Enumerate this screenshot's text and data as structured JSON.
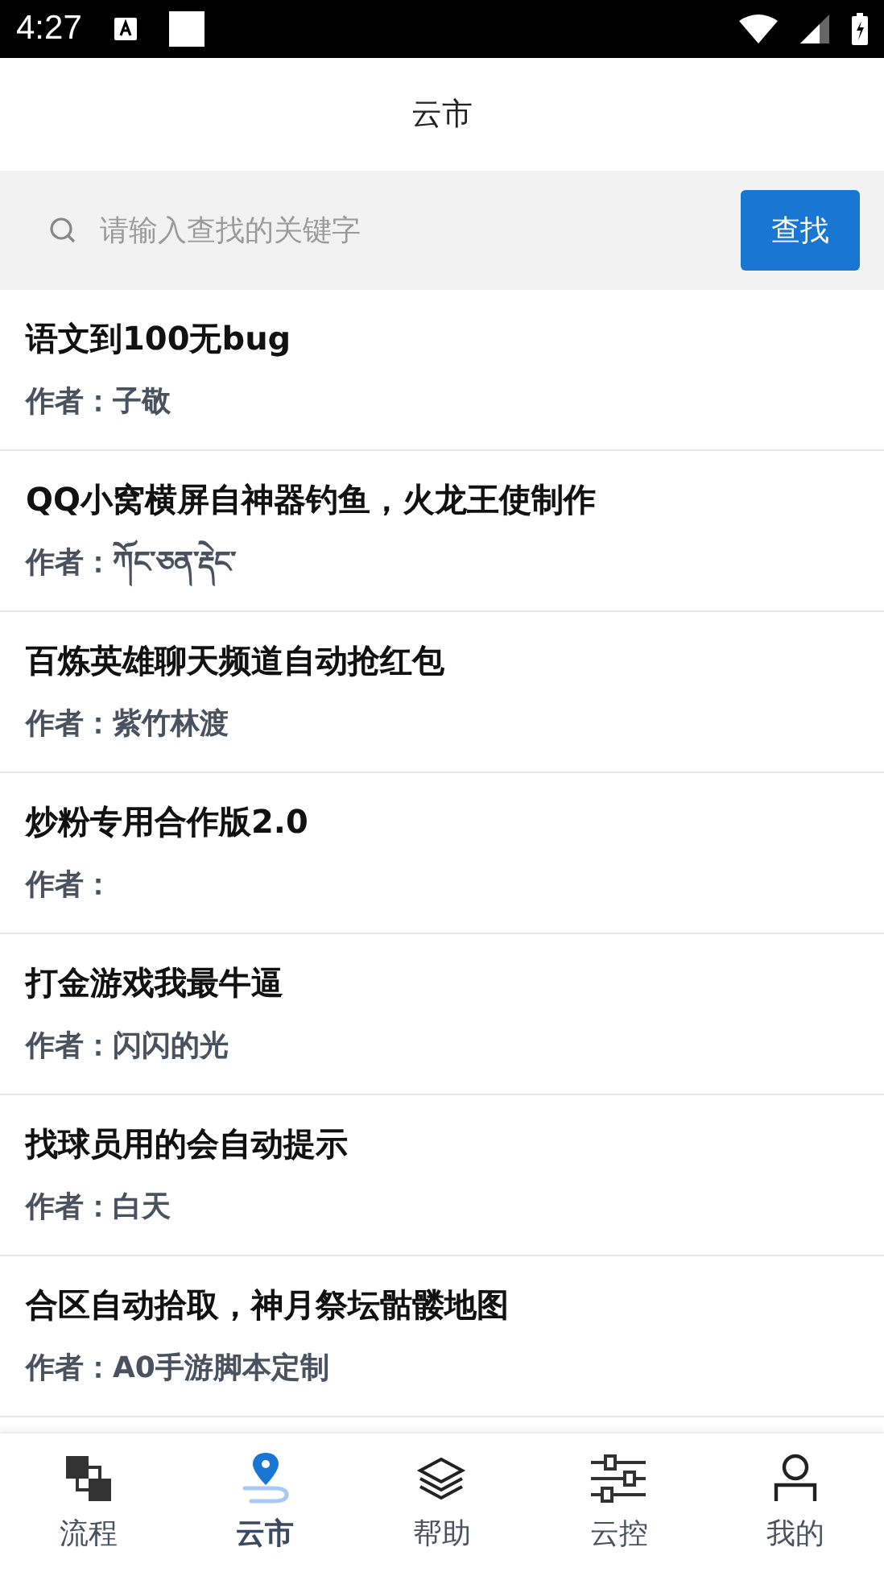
{
  "status_bar": {
    "time": "4:27"
  },
  "header": {
    "title": "云市"
  },
  "search": {
    "placeholder": "请输入查找的关键字",
    "button": "查找"
  },
  "scripts": [
    {
      "title": "语文到100无bug",
      "author": "作者：子敬"
    },
    {
      "title": "QQ小窝横屏自神器钓鱼，火龙王使制作",
      "author": "作者：ཀོང་ཅན་རྡེང་"
    },
    {
      "title": "百炼英雄聊天频道自动抢红包",
      "author": "作者：紫竹林渡"
    },
    {
      "title": "炒粉专用合作版2.0",
      "author": "作者："
    },
    {
      "title": "打金游戏我最牛逼",
      "author": "作者：闪闪的光"
    },
    {
      "title": "找球员用的会自动提示",
      "author": "作者：白天"
    },
    {
      "title": "合区自动拾取，神月祭坛骷髅地图",
      "author": "作者：A0手游脚本定制"
    }
  ],
  "nav": [
    {
      "kind": "flow",
      "label": "流程",
      "selected": false
    },
    {
      "kind": "market",
      "label": "云市",
      "selected": true
    },
    {
      "kind": "help",
      "label": "帮助",
      "selected": false
    },
    {
      "kind": "control",
      "label": "云控",
      "selected": false
    },
    {
      "kind": "user",
      "label": "我的",
      "selected": false
    }
  ]
}
